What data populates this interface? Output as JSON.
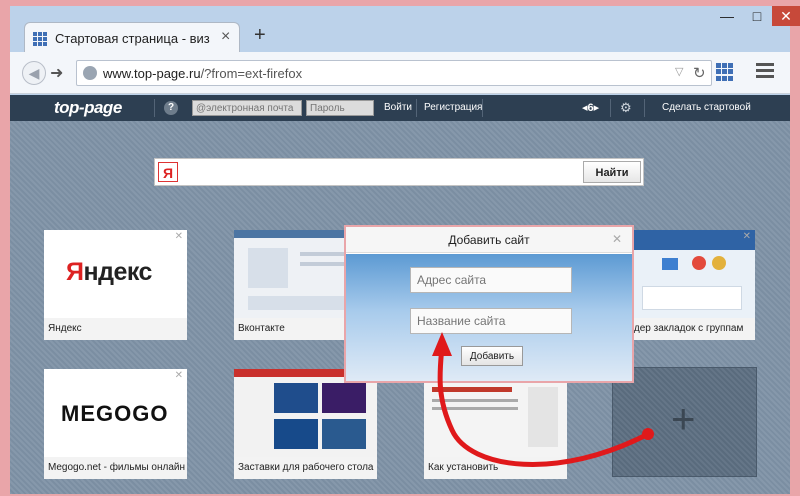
{
  "tab": {
    "title": "Стартовая страница - виз",
    "close": "×",
    "new_tab": "+"
  },
  "window": {
    "minimize": "—",
    "maximize": "□",
    "close": "✕"
  },
  "address": {
    "domain": "www.top-page.ru",
    "path": "/?from=ext-firefox"
  },
  "topbar": {
    "logo": "top-page",
    "help": "?",
    "email_placeholder": "@электронная почта",
    "password_placeholder": "Пароль",
    "login": "Войти",
    "register": "Регистрация",
    "pager": "◂6▸",
    "make_start": "Сделать стартовой"
  },
  "search": {
    "engine_icon": "Я",
    "button": "Найти"
  },
  "tiles": [
    {
      "label": "Яндекс",
      "logo_main": "ндекс",
      "logo_first": "Я"
    },
    {
      "label": "Вконтакте"
    },
    {
      "label": "едждер закладок с группам"
    },
    {
      "label": "Megogo.net - фильмы онлайн",
      "logo": "MEGOGO"
    },
    {
      "label": "Заставки для рабочего стола"
    },
    {
      "label": "Как установить"
    }
  ],
  "dialog": {
    "title": "Добавить сайт",
    "url_placeholder": "Адрес сайта",
    "name_placeholder": "Название сайта",
    "add_button": "Добавить"
  },
  "colors": {
    "accent": "#3f6fb5",
    "topbar": "#2d3f52",
    "arrow": "#e0191b",
    "frame": "#e9a5a9"
  }
}
